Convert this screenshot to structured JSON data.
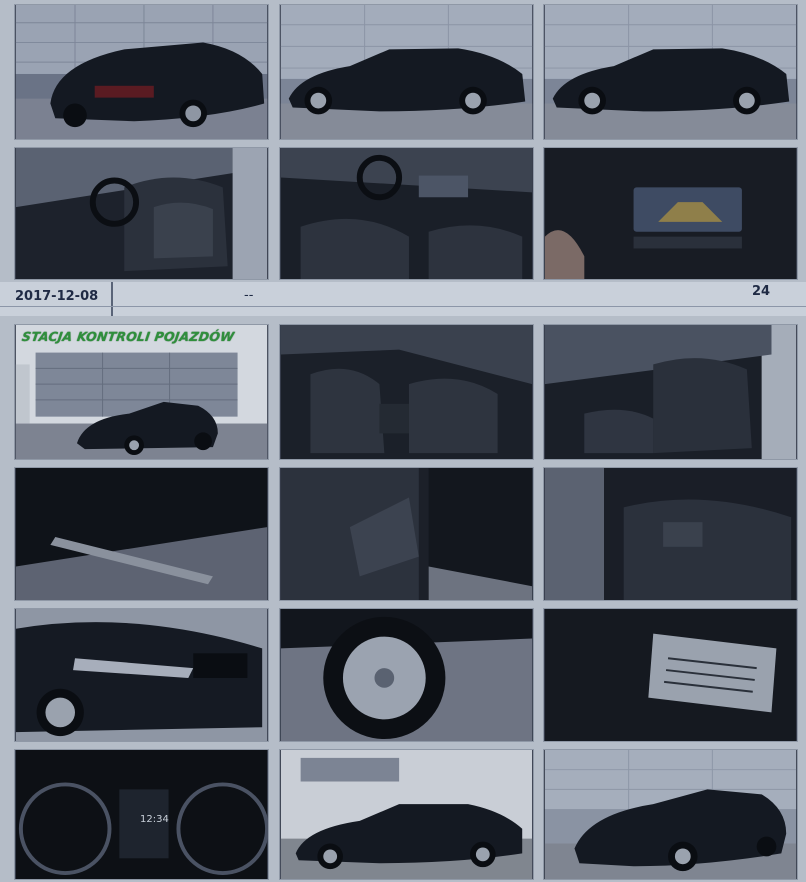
{
  "header_row": {
    "date": "2017-12-08",
    "middle": "--",
    "count": "24"
  },
  "sign_text": "STACJA KONTROLI POJAZDÓW",
  "dashboard": {
    "clock": "12:34"
  },
  "colors": {
    "background": "#b5bdc8",
    "car_body": "#141922",
    "building": "#d8dde4",
    "sign_green": "#2f8f3c"
  },
  "photos": [
    {
      "subject": "car-rear-left"
    },
    {
      "subject": "car-side-left"
    },
    {
      "subject": "car-side-left-2"
    },
    {
      "subject": "front-seats-door-open"
    },
    {
      "subject": "dashboard-interior"
    },
    {
      "subject": "infotainment-screen"
    },
    {
      "subject": "car-at-inspection-station"
    },
    {
      "subject": "front-seats-console"
    },
    {
      "subject": "driver-seat"
    },
    {
      "subject": "door-sill"
    },
    {
      "subject": "door-panel"
    },
    {
      "subject": "rear-seats"
    },
    {
      "subject": "front-headlight"
    },
    {
      "subject": "wheel-tire"
    },
    {
      "subject": "vin-sticker"
    },
    {
      "subject": "instrument-cluster"
    },
    {
      "subject": "car-side-street"
    },
    {
      "subject": "car-front-right"
    }
  ]
}
